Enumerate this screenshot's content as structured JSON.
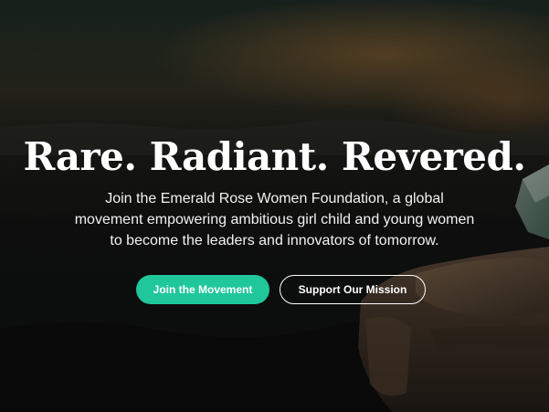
{
  "hero": {
    "headline": "Rare. Radiant. Revered.",
    "subtext": "Join the Emerald Rose Women Foundation, a global movement empowering ambitious girl child and young women to become the leaders and innovators of tomorrow.",
    "primary_button": "Join the Movement",
    "secondary_button": "Support Our Mission"
  },
  "colors": {
    "accent": "#1fc79a",
    "text": "#ffffff"
  }
}
